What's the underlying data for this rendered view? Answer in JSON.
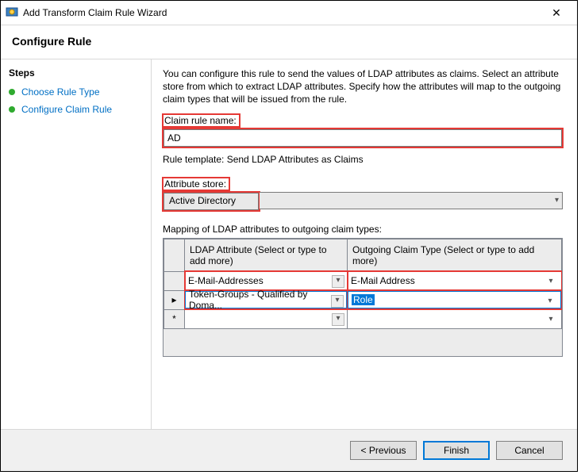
{
  "window": {
    "title": "Add Transform Claim Rule Wizard"
  },
  "header": "Configure Rule",
  "sidebar": {
    "heading": "Steps",
    "items": [
      {
        "label": "Choose Rule Type"
      },
      {
        "label": "Configure Claim Rule"
      }
    ]
  },
  "main": {
    "description": "You can configure this rule to send the values of LDAP attributes as claims. Select an attribute store from which to extract LDAP attributes. Specify how the attributes will map to the outgoing claim types that will be issued from the rule.",
    "claim_rule_name_label": "Claim rule name:",
    "claim_rule_name_value": "AD",
    "rule_template_label": "Rule template: Send LDAP Attributes as Claims",
    "attribute_store_label": "Attribute store:",
    "attribute_store_value": "Active Directory",
    "mapping_label": "Mapping of LDAP attributes to outgoing claim types:",
    "grid": {
      "col1_header": "LDAP Attribute (Select or type to add more)",
      "col2_header": "Outgoing Claim Type (Select or type to add more)",
      "rows": [
        {
          "marker": "",
          "ldap": "E-Mail-Addresses",
          "claim": "E-Mail Address"
        },
        {
          "marker": "▸",
          "ldap": "Token-Groups - Qualified by Doma...",
          "claim": "Role"
        },
        {
          "marker": "*",
          "ldap": "",
          "claim": ""
        }
      ]
    }
  },
  "footer": {
    "previous": "< Previous",
    "finish": "Finish",
    "cancel": "Cancel"
  }
}
